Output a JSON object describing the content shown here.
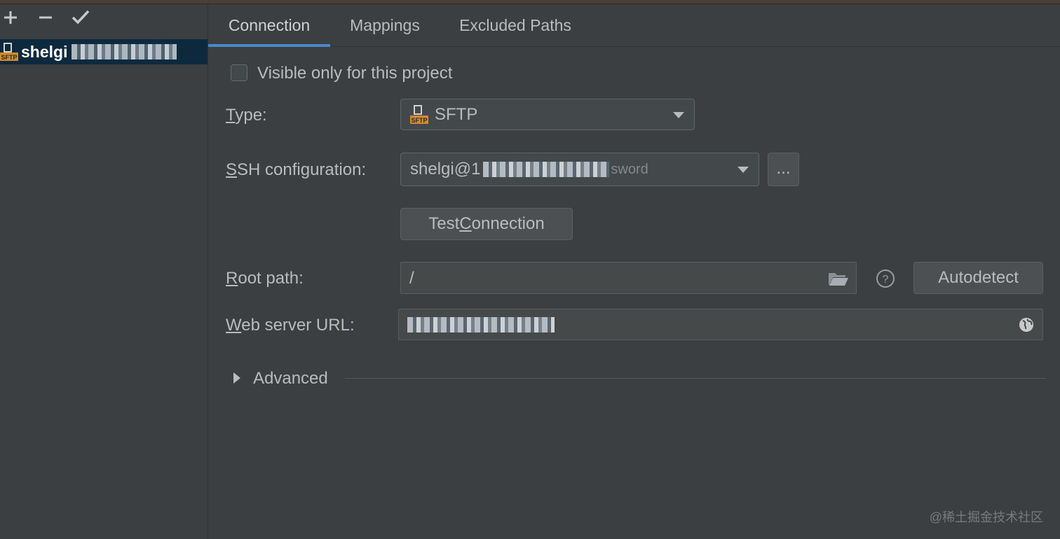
{
  "toolbar": {
    "add": "+",
    "remove": "−",
    "apply": "✓"
  },
  "server_list": {
    "item_name": "shelgi",
    "icon_text": "SFTP"
  },
  "tabs": [
    {
      "label": "Connection"
    },
    {
      "label": "Mappings"
    },
    {
      "label": "Excluded Paths"
    }
  ],
  "form": {
    "visible_only_label": "Visible only for this project",
    "type": {
      "label_first": "T",
      "label_rest": "ype:",
      "value": "SFTP",
      "icon_text": "SFTP"
    },
    "ssh": {
      "label_first": "S",
      "label_rest": "SH configuration:",
      "value": "shelgi@1",
      "suffix": "sword",
      "more_label": "..."
    },
    "test_connection": {
      "before": "Test ",
      "underline": "C",
      "after": "onnection"
    },
    "root_path": {
      "label_first": "R",
      "label_rest": "oot path:",
      "value": "/"
    },
    "autodetect_label": "Autodetect",
    "web_url": {
      "label_first": "W",
      "label_rest": "eb server URL:"
    },
    "advanced_label": "Advanced"
  },
  "watermark": "@稀土掘金技术社区",
  "colors": {
    "accent": "#4a88c7",
    "background": "#3c3f41",
    "selection": "#0d293e",
    "sftp_orange": "#d18b2c"
  }
}
